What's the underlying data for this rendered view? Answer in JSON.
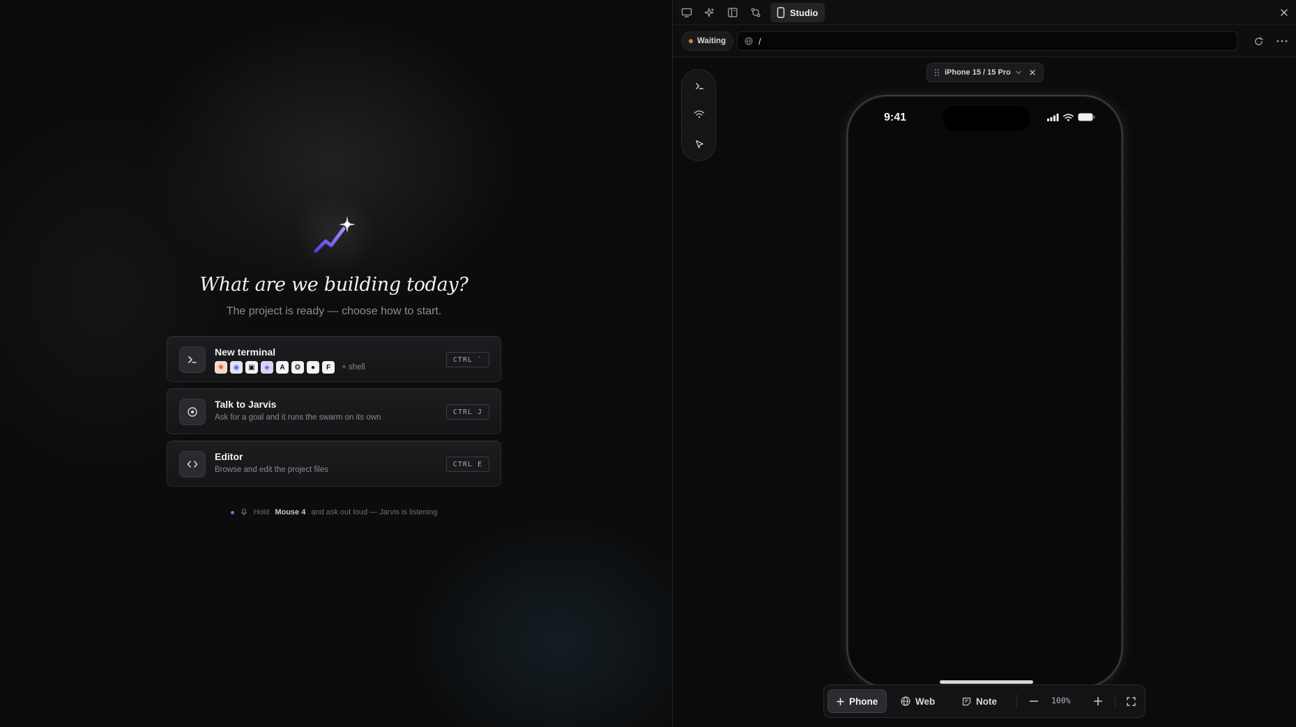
{
  "welcome": {
    "headline": "What are we building today?",
    "subline": "The project is ready — choose how to start.",
    "cards": [
      {
        "title": "New terminal",
        "desc": "",
        "extra": "+ shell",
        "shortcut": "CTRL `"
      },
      {
        "title": "Talk to Jarvis",
        "desc": "Ask for a goal and it runs the swarm on its own",
        "shortcut": "CTRL J"
      },
      {
        "title": "Editor",
        "desc": "Browse and edit the project files",
        "shortcut": "CTRL E"
      }
    ],
    "agents": [
      {
        "icon": "claude-icon",
        "glyph": "✺",
        "bg": "#f3d9cc",
        "fg": "#d9663a"
      },
      {
        "icon": "gemini-icon",
        "glyph": "◉",
        "bg": "#dfe4f8",
        "fg": "#4f6ad6"
      },
      {
        "icon": "codex-icon",
        "glyph": "▣",
        "bg": "#f2f2f2",
        "fg": "#111111"
      },
      {
        "icon": "cursor-icon",
        "glyph": "◈",
        "bg": "#d9d4f7",
        "fg": "#6a54d8"
      },
      {
        "icon": "amp-icon",
        "glyph": "A",
        "bg": "#f2f2f2",
        "fg": "#111111"
      },
      {
        "icon": "openai-icon",
        "glyph": "❂",
        "bg": "#f2f2f2",
        "fg": "#111111"
      },
      {
        "icon": "github-icon",
        "glyph": "●",
        "bg": "#f2f2f2",
        "fg": "#111111"
      },
      {
        "icon": "factory-icon",
        "glyph": "F",
        "bg": "#f2f2f2",
        "fg": "#111111"
      }
    ],
    "hint": {
      "pre": "Hold",
      "key": "Mouse 4",
      "post": "and ask out loud — Jarvis is listening"
    }
  },
  "studio": {
    "tab_label": "Studio",
    "status": "Waiting",
    "url": "/",
    "device": "iPhone 15 / 15 Pro",
    "phone_time": "9:41",
    "dock": {
      "phone": "Phone",
      "web": "Web",
      "note": "Note",
      "zoom": "100%"
    }
  },
  "colors": {
    "accent_purple": "#7b5cf0",
    "status_waiting": "#c58a2e"
  }
}
